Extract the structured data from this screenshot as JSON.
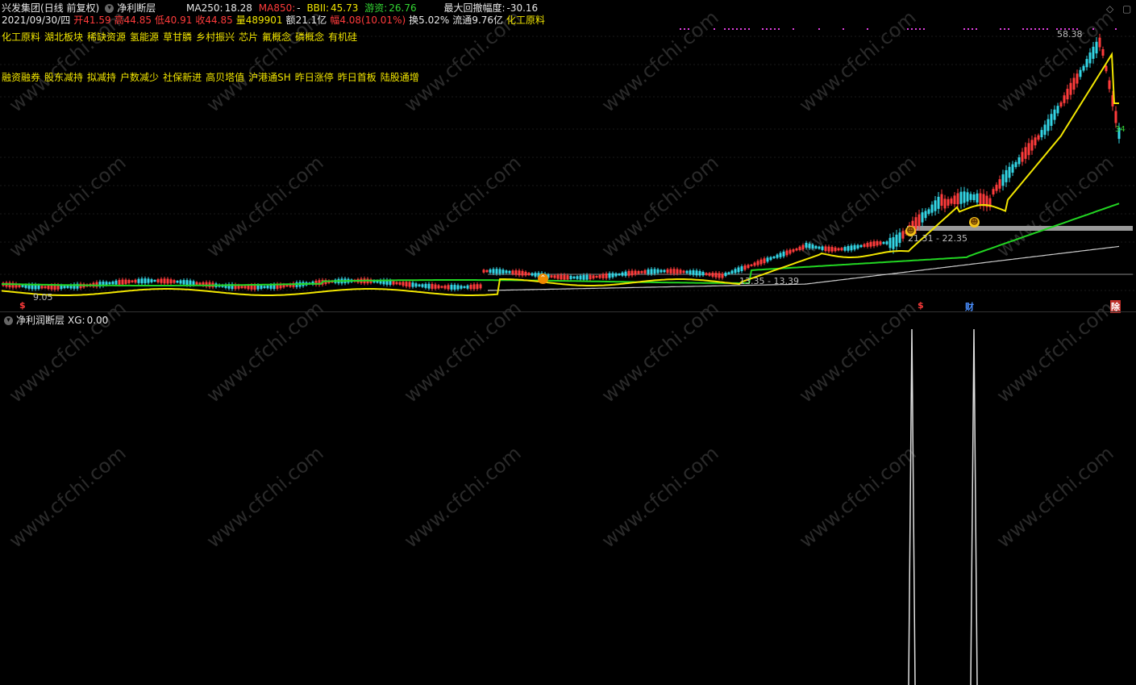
{
  "header": {
    "stock_name": "兴发集团",
    "period": "(日线 前复权)",
    "indicator_name": "净利断层",
    "ma250_label": "MA250:",
    "ma250_value": "18.28",
    "ma850_label": "MA850:",
    "ma850_value": "-",
    "bbii_label": "BBII:",
    "bbii_value": "45.73",
    "youzi_label": "游资:",
    "youzi_value": "26.76",
    "max_drawdown_label": "最大回撤幅度:",
    "max_drawdown_value": "-30.16"
  },
  "quote": {
    "date": "2021/09/30/四",
    "open_label": "开",
    "open": "41.59",
    "high_label": "高",
    "high": "44.85",
    "low_label": "低",
    "low": "40.91",
    "close_label": "收",
    "close": "44.85",
    "volume_label": "量",
    "volume": "489901",
    "amount_label": "额",
    "amount": "21.1亿",
    "change_label": "幅",
    "change": "4.08(10.01%)",
    "turnover_label": "换",
    "turnover": "5.02%",
    "float_label": "流通",
    "float": "9.76亿",
    "sector": "化工原料"
  },
  "concept_tags": [
    "化工原料",
    "湖北板块",
    "稀缺资源",
    "氢能源",
    "草甘膦",
    "乡村振兴",
    "芯片",
    "氟概念",
    "磷概念",
    "有机硅"
  ],
  "feature_tags": [
    "融资融券",
    "股东减持",
    "拟减持",
    "户数减少",
    "社保新进",
    "高贝塔值",
    "沪港通SH",
    "昨日涨停",
    "昨日首板",
    "陆股通增"
  ],
  "chart_labels": {
    "peak_price": "58.38",
    "gap_upper": "21.31 - 22.35",
    "gap_lower": "13.35 - 13.39",
    "left_price": "9.05",
    "last_count": "34"
  },
  "bottom_markers": {
    "s1": "$",
    "s2": "$",
    "cai": "财",
    "jin": "除"
  },
  "sub_panel": {
    "title": "净利润断层",
    "xg_label": "XG:",
    "xg_value": "0.00"
  },
  "watermark": "www.cfchi.com",
  "colors": {
    "up": "#ff3b3b",
    "down": "#33d6e6",
    "ma_yellow": "#f2e600",
    "ma_green": "#22d622",
    "ma_white": "#cccccc",
    "tag_yellow": "#f2e600",
    "dots_magenta": "#e040e0"
  }
}
